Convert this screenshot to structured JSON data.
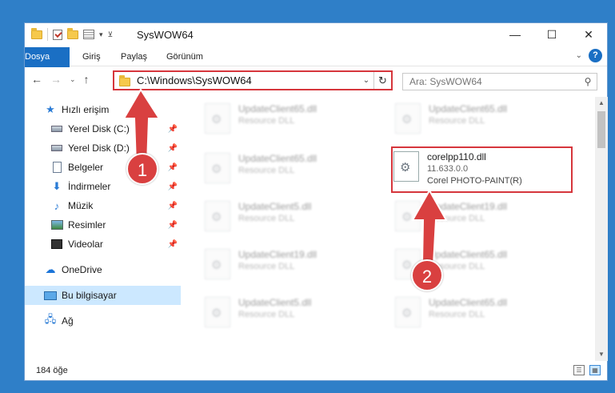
{
  "window": {
    "title": "SysWOW64"
  },
  "ribbon": {
    "tabs": [
      "Dosya",
      "Giriş",
      "Paylaş",
      "Görünüm"
    ]
  },
  "address": {
    "path": "C:\\Windows\\SysWOW64"
  },
  "search": {
    "placeholder": "Ara: SysWOW64"
  },
  "sidebar": {
    "items": [
      {
        "label": "Hızlı erişim",
        "icon": "star-icon"
      },
      {
        "label": "Yerel Disk (C:)",
        "icon": "drive-icon",
        "pinned": true
      },
      {
        "label": "Yerel Disk (D:)",
        "icon": "drive-icon",
        "pinned": true
      },
      {
        "label": "Belgeler",
        "icon": "document-icon",
        "pinned": true
      },
      {
        "label": "İndirmeler",
        "icon": "download-icon",
        "pinned": true
      },
      {
        "label": "Müzik",
        "icon": "music-icon",
        "pinned": true
      },
      {
        "label": "Resimler",
        "icon": "picture-icon",
        "pinned": true
      },
      {
        "label": "Videolar",
        "icon": "video-icon",
        "pinned": true
      },
      {
        "label": "OneDrive",
        "icon": "cloud-icon"
      },
      {
        "label": "Bu bilgisayar",
        "icon": "computer-icon",
        "selected": true
      },
      {
        "label": "Ağ",
        "icon": "network-icon"
      }
    ]
  },
  "files": {
    "left": [
      {
        "name": "UpdateClient65.dll",
        "sub": "Resource DLL"
      },
      {
        "name": "UpdateClient65.dll",
        "sub": "Resource DLL"
      },
      {
        "name": "UpdateClient5.dll",
        "sub": "Resource DLL"
      },
      {
        "name": "UpdateClient19.dll",
        "sub": "Resource DLL"
      },
      {
        "name": "UpdateClient5.dll",
        "sub": "Resource DLL"
      }
    ],
    "right": [
      {
        "name": "UpdateClient65.dll",
        "sub": "Resource DLL"
      },
      {
        "name": "corelpp110.dll",
        "version": "11.633.0.0",
        "company": "Corel PHOTO-PAINT(R)",
        "focused": true
      },
      {
        "name": "UpdateClient19.dll",
        "sub": "Resource DLL"
      },
      {
        "name": "UpdateClient65.dll",
        "sub": "Resource DLL"
      },
      {
        "name": "UpdateClient65.dll",
        "sub": "Resource DLL"
      }
    ]
  },
  "status": {
    "count": "184 öğe"
  },
  "annotations": {
    "step1": "1",
    "step2": "2",
    "color": "#d94040"
  }
}
